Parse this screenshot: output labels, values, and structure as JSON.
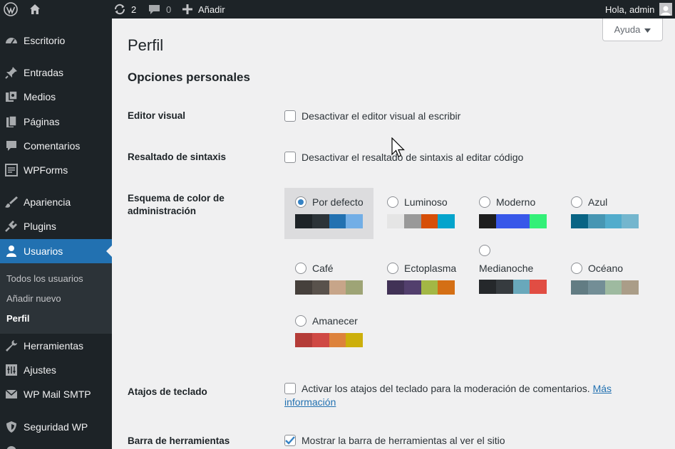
{
  "adminbar": {
    "updates_count": "2",
    "comments_count": "0",
    "new_label": "Añadir",
    "greeting": "Hola, admin"
  },
  "sidebar": {
    "items": [
      {
        "label": "Escritorio",
        "icon": "dashboard-icon"
      },
      {
        "label": "Entradas",
        "icon": "pin-icon"
      },
      {
        "label": "Medios",
        "icon": "media-icon"
      },
      {
        "label": "Páginas",
        "icon": "pages-icon"
      },
      {
        "label": "Comentarios",
        "icon": "comments-icon"
      },
      {
        "label": "WPForms",
        "icon": "wpforms-icon"
      },
      {
        "label": "Apariencia",
        "icon": "appearance-icon"
      },
      {
        "label": "Plugins",
        "icon": "plugins-icon"
      },
      {
        "label": "Usuarios",
        "icon": "users-icon"
      },
      {
        "label": "Herramientas",
        "icon": "tools-icon"
      },
      {
        "label": "Ajustes",
        "icon": "settings-icon"
      },
      {
        "label": "WP Mail SMTP",
        "icon": "mail-icon"
      },
      {
        "label": "Seguridad WP",
        "icon": "shield-icon"
      }
    ],
    "submenu": [
      {
        "label": "Todos los usuarios"
      },
      {
        "label": "Añadir nuevo"
      },
      {
        "label": "Perfil"
      }
    ]
  },
  "help": {
    "label": "Ayuda"
  },
  "page": {
    "title": "Perfil",
    "section_title": "Opciones personales"
  },
  "fields": {
    "visual_editor": {
      "label": "Editor visual",
      "checkbox_label": "Desactivar el editor visual al escribir",
      "checked": false
    },
    "syntax": {
      "label": "Resaltado de sintaxis",
      "checkbox_label": "Desactivar el resaltado de sintaxis al editar código",
      "checked": false
    },
    "color_scheme": {
      "label": "Esquema de color de administración",
      "schemes": [
        {
          "name": "Por defecto",
          "colors": [
            "#1d2327",
            "#2c3338",
            "#2271b1",
            "#72aee6"
          ],
          "selected": true
        },
        {
          "name": "Luminoso",
          "colors": [
            "#e5e5e5",
            "#999999",
            "#d64e07",
            "#04a4cc"
          ],
          "selected": false
        },
        {
          "name": "Moderno",
          "colors": [
            "#1e1e1e",
            "#3858e9",
            "#3858e9",
            "#33f078"
          ],
          "selected": false
        },
        {
          "name": "Azul",
          "colors": [
            "#096484",
            "#4796b3",
            "#52accc",
            "#74b6ce"
          ],
          "selected": false
        },
        {
          "name": "Café",
          "colors": [
            "#46403c",
            "#59524c",
            "#c7a589",
            "#9ea476"
          ],
          "selected": false
        },
        {
          "name": "Ectoplasma",
          "colors": [
            "#413256",
            "#523f6d",
            "#a3b745",
            "#d46f15"
          ],
          "selected": false
        },
        {
          "name": "Medianoche",
          "colors": [
            "#25282b",
            "#363b3f",
            "#69a8bb",
            "#e14d43"
          ],
          "selected": false
        },
        {
          "name": "Océano",
          "colors": [
            "#627c83",
            "#738e96",
            "#9ebaa0",
            "#aa9d88"
          ],
          "selected": false
        },
        {
          "name": "Amanecer",
          "colors": [
            "#b43c38",
            "#cf4944",
            "#dd823b",
            "#ccaf0b"
          ],
          "selected": false
        }
      ]
    },
    "shortcuts": {
      "label": "Atajos de teclado",
      "checkbox_label": "Activar los atajos del teclado para la moderación de comentarios.",
      "link_part1": "Más",
      "link_part2": "información",
      "checked": false
    },
    "toolbar": {
      "label": "Barra de herramientas",
      "checkbox_label": "Mostrar la barra de herramientas al ver el sitio",
      "checked": true
    }
  },
  "colors": {
    "accent": "#2271b1",
    "sidebar_bg": "#1d2327",
    "submenu_bg": "#2c3338",
    "page_bg": "#f0f0f1"
  }
}
